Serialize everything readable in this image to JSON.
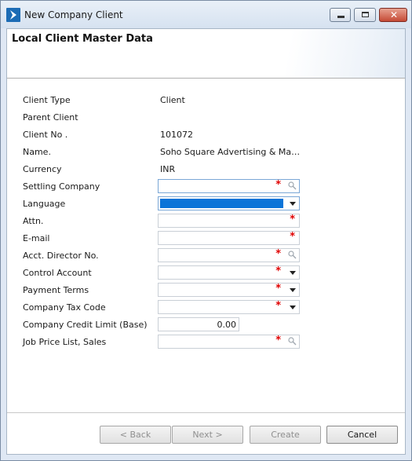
{
  "window": {
    "title": "New Company Client"
  },
  "page": {
    "title": "Local Client Master Data"
  },
  "fields": [
    {
      "label": "Client Type",
      "value": "Client"
    },
    {
      "label": "Parent Client",
      "value": ""
    },
    {
      "label": "Client No .",
      "value": "101072"
    },
    {
      "label": "Name.",
      "value": "Soho Square Advertising & Mar..."
    },
    {
      "label": "Currency",
      "value": "INR"
    },
    {
      "label": "Settling Company",
      "required_mark": "*"
    },
    {
      "label": "Language"
    },
    {
      "label": "Attn.",
      "required_mark": "*"
    },
    {
      "label": "E-mail",
      "required_mark": "*"
    },
    {
      "label": "Acct. Director No.",
      "required_mark": "*"
    },
    {
      "label": "Control Account",
      "required_mark": "*"
    },
    {
      "label": "Payment Terms",
      "required_mark": "*"
    },
    {
      "label": "Company Tax Code",
      "required_mark": "*"
    },
    {
      "label": "Company Credit Limit (Base)",
      "value": "0.00"
    },
    {
      "label": "Job Price List, Sales",
      "required_mark": "*"
    }
  ],
  "buttons": {
    "back": "< Back",
    "next": "Next >",
    "create": "Create",
    "cancel": "Cancel"
  },
  "colors": {
    "selection": "#0a74d8",
    "required": "#e00000",
    "accent": "#1c6cb5"
  }
}
